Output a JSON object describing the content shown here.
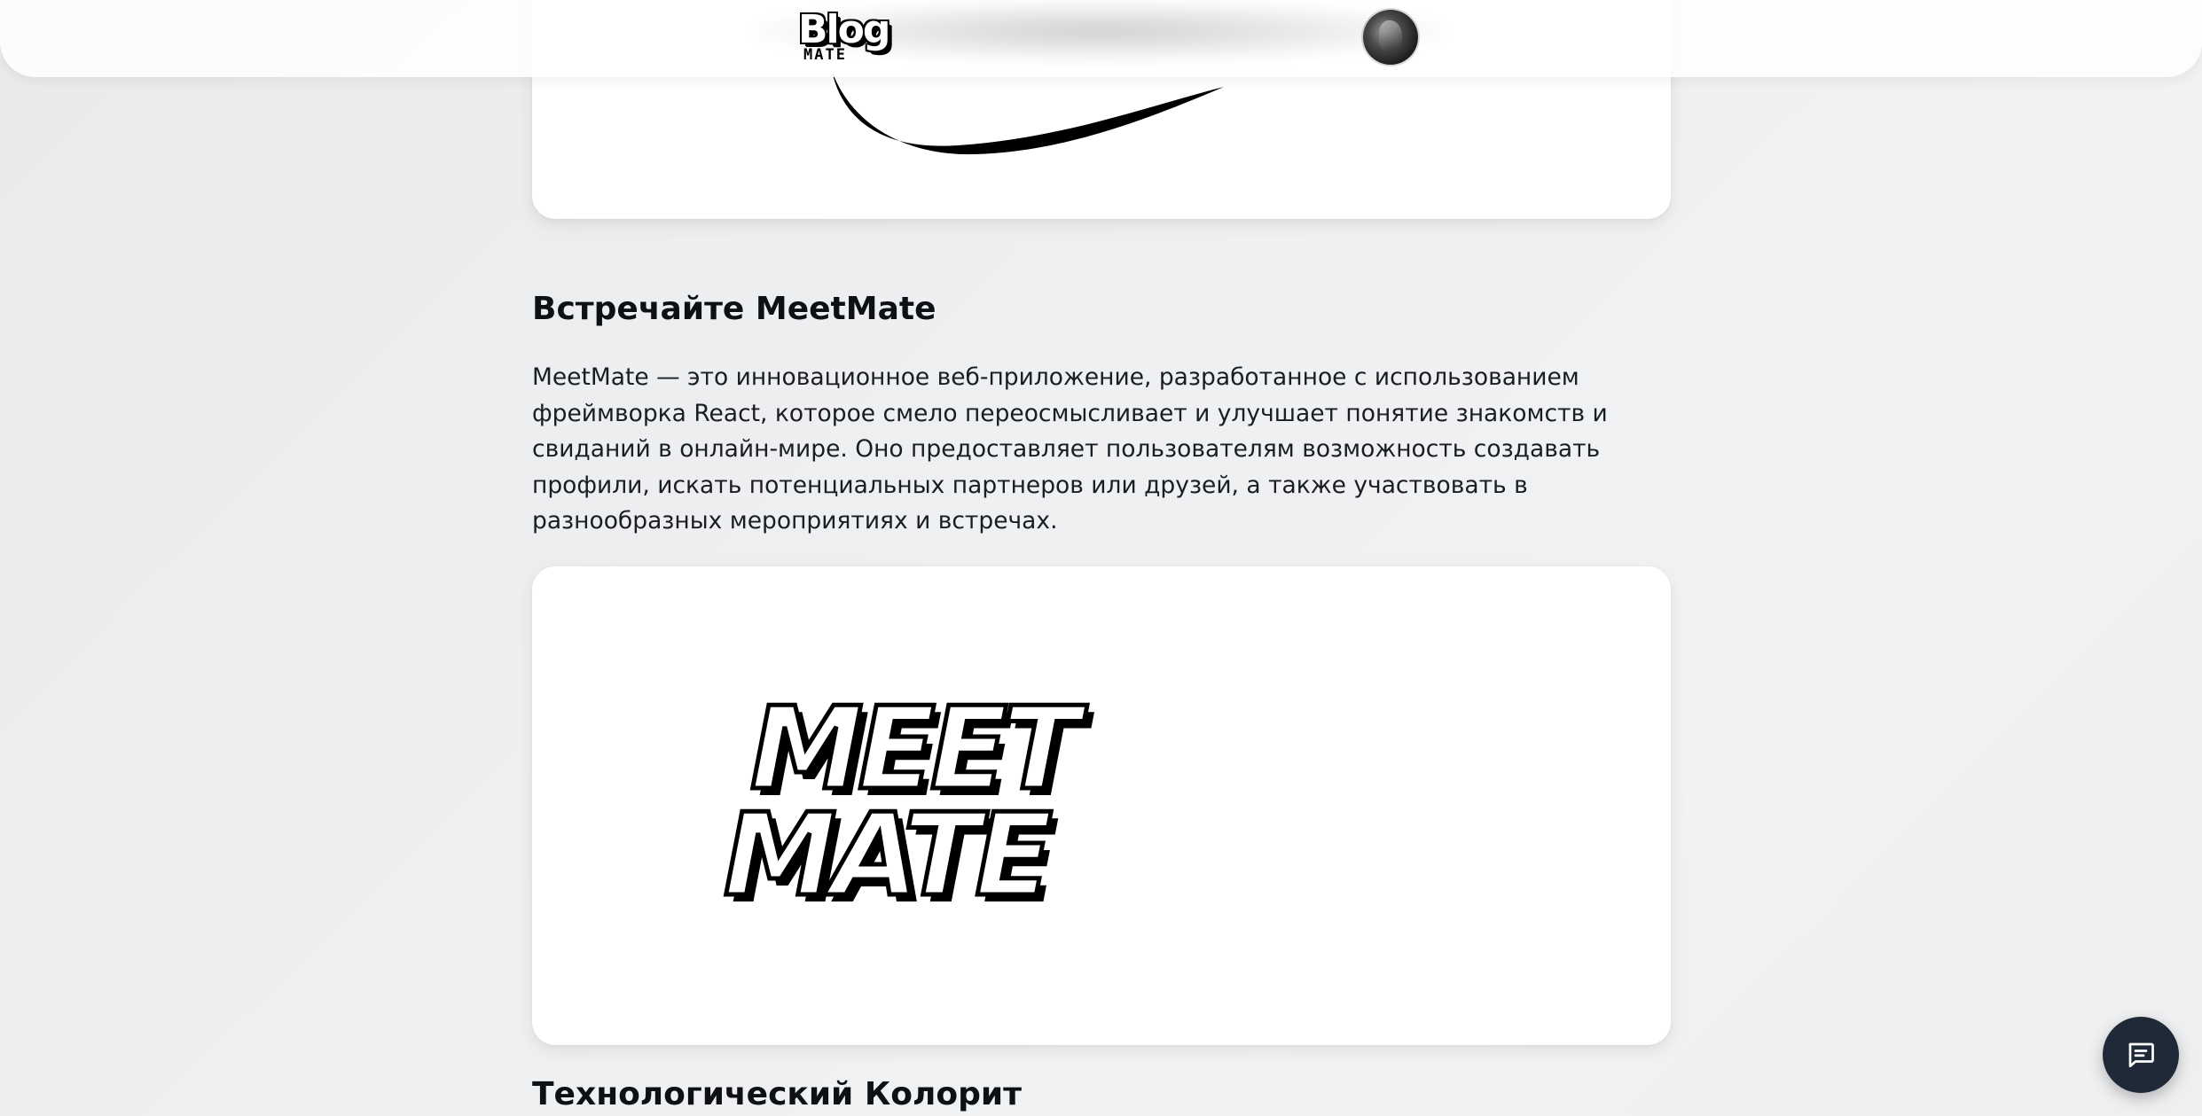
{
  "header": {
    "logo_main": "Blog",
    "logo_sub": "MATE",
    "avatar_icon": "user-avatar"
  },
  "article": {
    "section_1": {
      "title": "Встречайте MeetMate",
      "paragraph": "MeetMate — это инновационное веб-приложение, разработанное с использованием фреймворка React, которое смело переосмысливает и улучшает понятие знакомств и свиданий в онлайн-мире. Оно предоставляет пользователям возможность создавать профили, искать потенциальных партнеров или друзей, а также участвовать в разнообразных мероприятиях и встречах.",
      "image_text_line_1": "MEET",
      "image_text_line_2": "MATE"
    },
    "section_2": {
      "title": "Технологический Колорит"
    }
  },
  "chat": {
    "icon": "chat-icon"
  },
  "colors": {
    "background": "#eeeff1",
    "card": "#ffffff",
    "text": "#111418",
    "fab": "#1f2937"
  }
}
